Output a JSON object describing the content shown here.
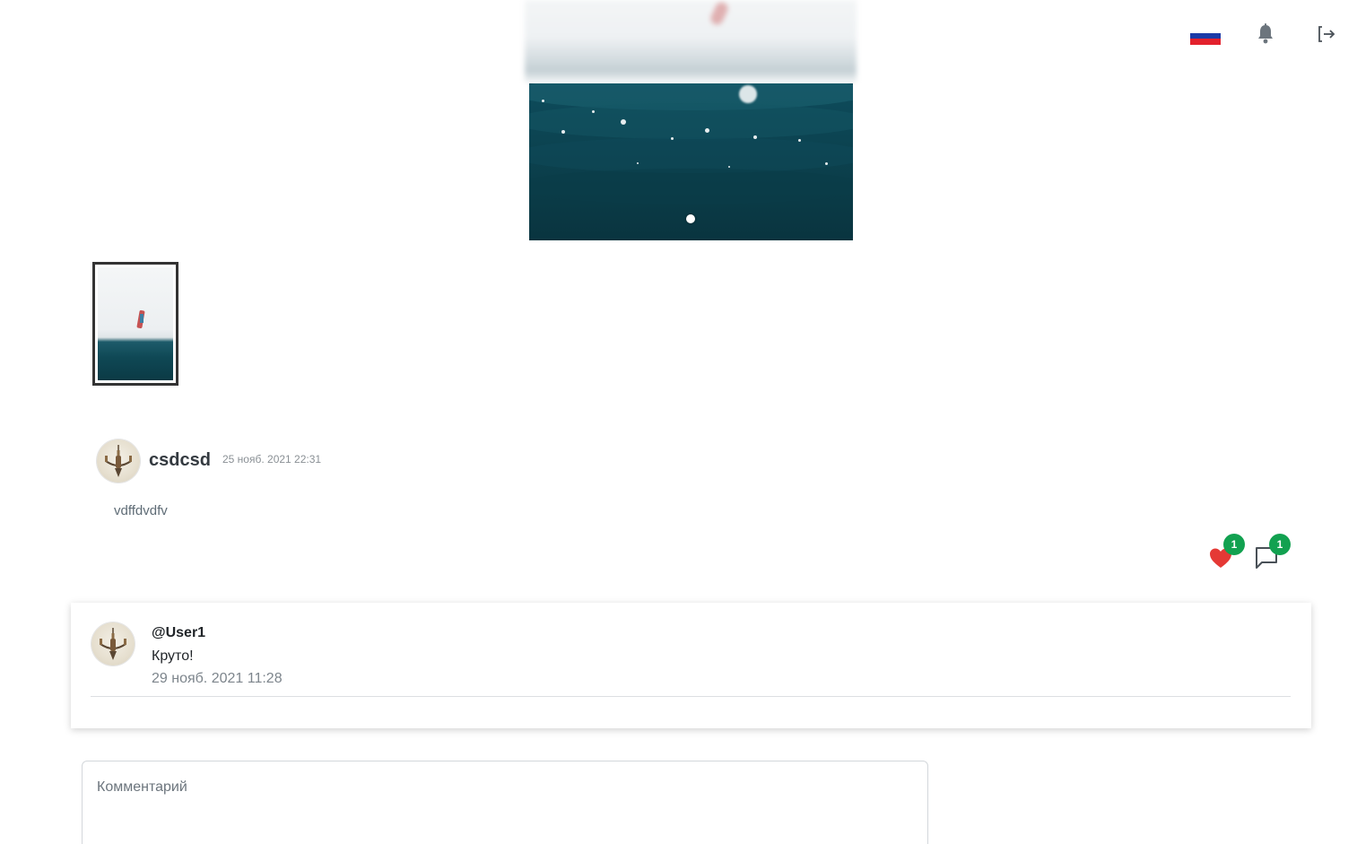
{
  "header": {
    "language_flag": "russia-flag",
    "notifications_icon": "bell-icon",
    "logout_icon": "logout-icon"
  },
  "gallery": {
    "slide_count": 1,
    "active_slide": 1
  },
  "post": {
    "author": "csdcsd",
    "date": "25 нояб. 2021 22:31",
    "text": "vdffdvdfv",
    "likes": "1",
    "comments": "1"
  },
  "comments": [
    {
      "user": "@User1",
      "text": "Круто!",
      "date": "29 нояб. 2021 11:28"
    }
  ],
  "comment_input": {
    "placeholder": "Комментарий"
  },
  "colors": {
    "badge": "#12a150",
    "like_heart": "#e53935",
    "water": "#0c4452"
  }
}
